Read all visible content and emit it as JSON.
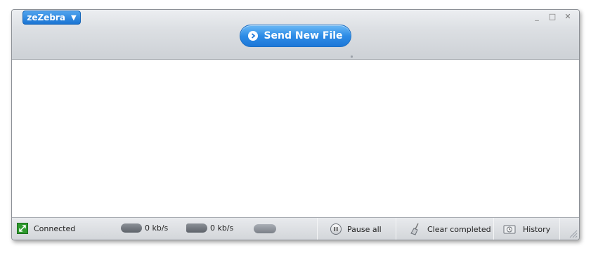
{
  "header": {
    "brand_label": "zeZebra",
    "brand_caret": "▼",
    "send_label": "Send New File",
    "window_controls": [
      "_",
      "□",
      "✕"
    ]
  },
  "statusbar": {
    "connection_label": "Connected",
    "download_speed": "0 kb/s",
    "upload_speed": "0 kb/s",
    "pause_label": "Pause all",
    "clear_label": "Clear completed",
    "history_label": "History"
  },
  "colors": {
    "accent": "#2e8ce6",
    "connected": "#2e9a2e"
  },
  "icons": [
    "play-circle-icon",
    "connection-icon",
    "pause-icon",
    "broom-icon",
    "history-icon",
    "resize-grip-icon"
  ]
}
